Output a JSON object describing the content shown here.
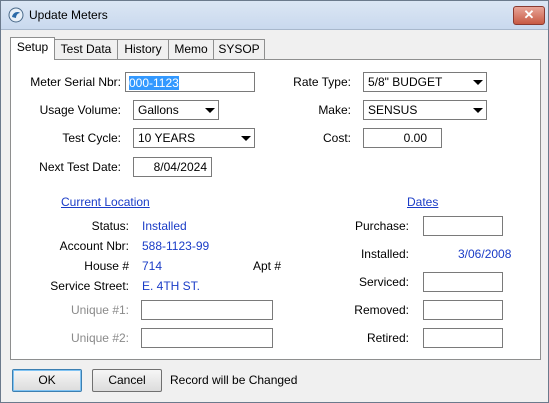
{
  "window": {
    "title": "Update Meters",
    "close_label": "✕"
  },
  "tabs": [
    "Setup",
    "Test Data",
    "History",
    "Memo",
    "SYSOP"
  ],
  "setup": {
    "meter_serial": {
      "label": "Meter Serial Nbr:",
      "value": "000-1123"
    },
    "usage_volume": {
      "label": "Usage Volume:",
      "value": "Gallons"
    },
    "test_cycle": {
      "label": "Test Cycle:",
      "value": "10 YEARS"
    },
    "next_test_date": {
      "label": "Next Test Date:",
      "value": "8/04/2024"
    },
    "rate_type": {
      "label": "Rate Type:",
      "value": "5/8\" BUDGET"
    },
    "make": {
      "label": "Make:",
      "value": "SENSUS"
    },
    "cost": {
      "label": "Cost:",
      "value": "0.00"
    }
  },
  "location": {
    "heading": "Current Location",
    "status": {
      "label": "Status:",
      "value": "Installed"
    },
    "account": {
      "label": "Account Nbr:",
      "value": "588-1123-99"
    },
    "house": {
      "label": "House #",
      "value": "714"
    },
    "apt": {
      "label": "Apt #",
      "value": ""
    },
    "street": {
      "label": "Service Street:",
      "value": "E. 4TH ST."
    },
    "unique1": {
      "label": "Unique #1:",
      "value": ""
    },
    "unique2": {
      "label": "Unique #2:",
      "value": ""
    }
  },
  "dates": {
    "heading": "Dates",
    "purchase": {
      "label": "Purchase:",
      "value": ""
    },
    "installed": {
      "label": "Installed:",
      "value": "3/06/2008"
    },
    "serviced": {
      "label": "Serviced:",
      "value": ""
    },
    "removed": {
      "label": "Removed:",
      "value": ""
    },
    "retired": {
      "label": "Retired:",
      "value": ""
    }
  },
  "footer": {
    "ok": "OK",
    "cancel": "Cancel",
    "status": "Record will be Changed"
  }
}
